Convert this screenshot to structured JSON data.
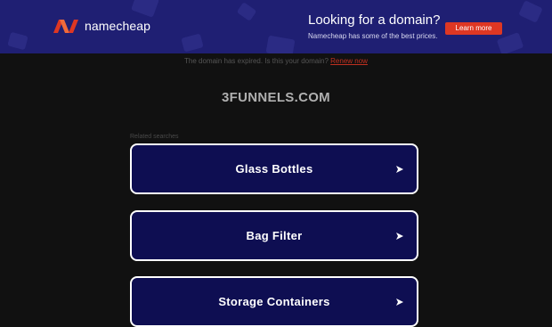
{
  "banner": {
    "brand_name": "namecheap",
    "promo_title": "Looking for a domain?",
    "promo_subtitle": "Namecheap has some of the best prices.",
    "cta_label": "Learn more"
  },
  "notice": {
    "text": "The domain has expired. Is this your domain?",
    "link_label": "Renew now"
  },
  "domain": "3FUNNELS.COM",
  "related": {
    "label": "Related searches",
    "items": [
      {
        "label": "Glass Bottles"
      },
      {
        "label": "Bag Filter"
      },
      {
        "label": "Storage Containers"
      }
    ]
  },
  "colors": {
    "banner_bg": "#1f1f73",
    "accent": "#de3723",
    "card_bg": "#0e0e52",
    "page_bg": "#111111"
  }
}
